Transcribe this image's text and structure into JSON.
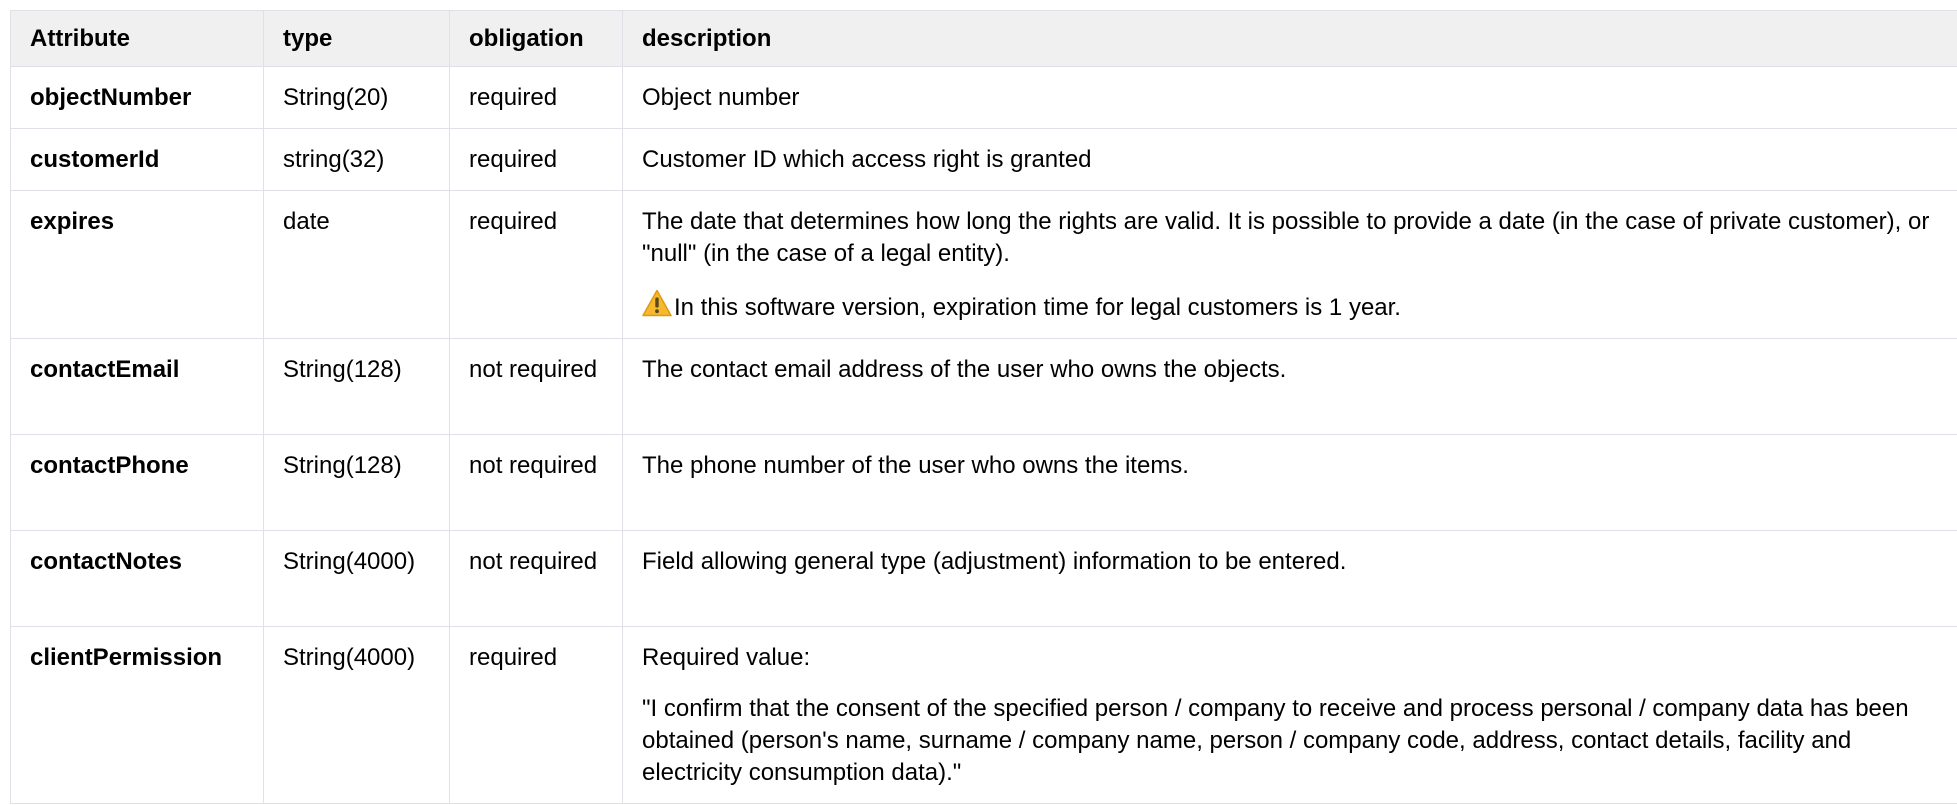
{
  "table": {
    "headers": {
      "attribute": "Attribute",
      "type": "type",
      "obligation": "obligation",
      "description": "description"
    },
    "rows": [
      {
        "attribute": "objectNumber",
        "type": "String(20)",
        "obligation": "required",
        "description": [
          "Object number"
        ]
      },
      {
        "attribute": "customerId",
        "type": "string(32)",
        "obligation": "required",
        "description": [
          "Customer ID which access right is granted"
        ]
      },
      {
        "attribute": "expires",
        "type": "date",
        "obligation": "required",
        "description": [
          "The date that determines how long the rights are valid. It is possible to provide a date (in the case of private customer), or \"null\" (in the case of a legal entity)."
        ],
        "warning": "In this software version, expiration time for legal customers is 1 year."
      },
      {
        "attribute": "contactEmail",
        "type": "String(128)",
        "obligation": "not required",
        "description": [
          "The contact email address of the user who owns the objects."
        ]
      },
      {
        "attribute": "contactPhone",
        "type": "String(128)",
        "obligation": "not required",
        "description": [
          "The phone number of the user who owns the items."
        ]
      },
      {
        "attribute": "contactNotes",
        "type": "String(4000)",
        "obligation": "not required",
        "description": [
          "Field allowing general type (adjustment) information to be entered."
        ]
      },
      {
        "attribute": "clientPermission",
        "type": "String(4000)",
        "obligation": "required",
        "description": [
          "Required value:",
          "\"I confirm that the consent of the specified person / company to receive and process personal / company data has been obtained (person's name, surname / company name, person / company code, address, contact details, facility and electricity consumption data).\""
        ]
      }
    ]
  },
  "icons": {
    "warning": "warning-icon"
  },
  "colors": {
    "header_bg": "#f0f0f0",
    "border": "#dfe1e6",
    "warning_fill": "#f5b82e"
  }
}
